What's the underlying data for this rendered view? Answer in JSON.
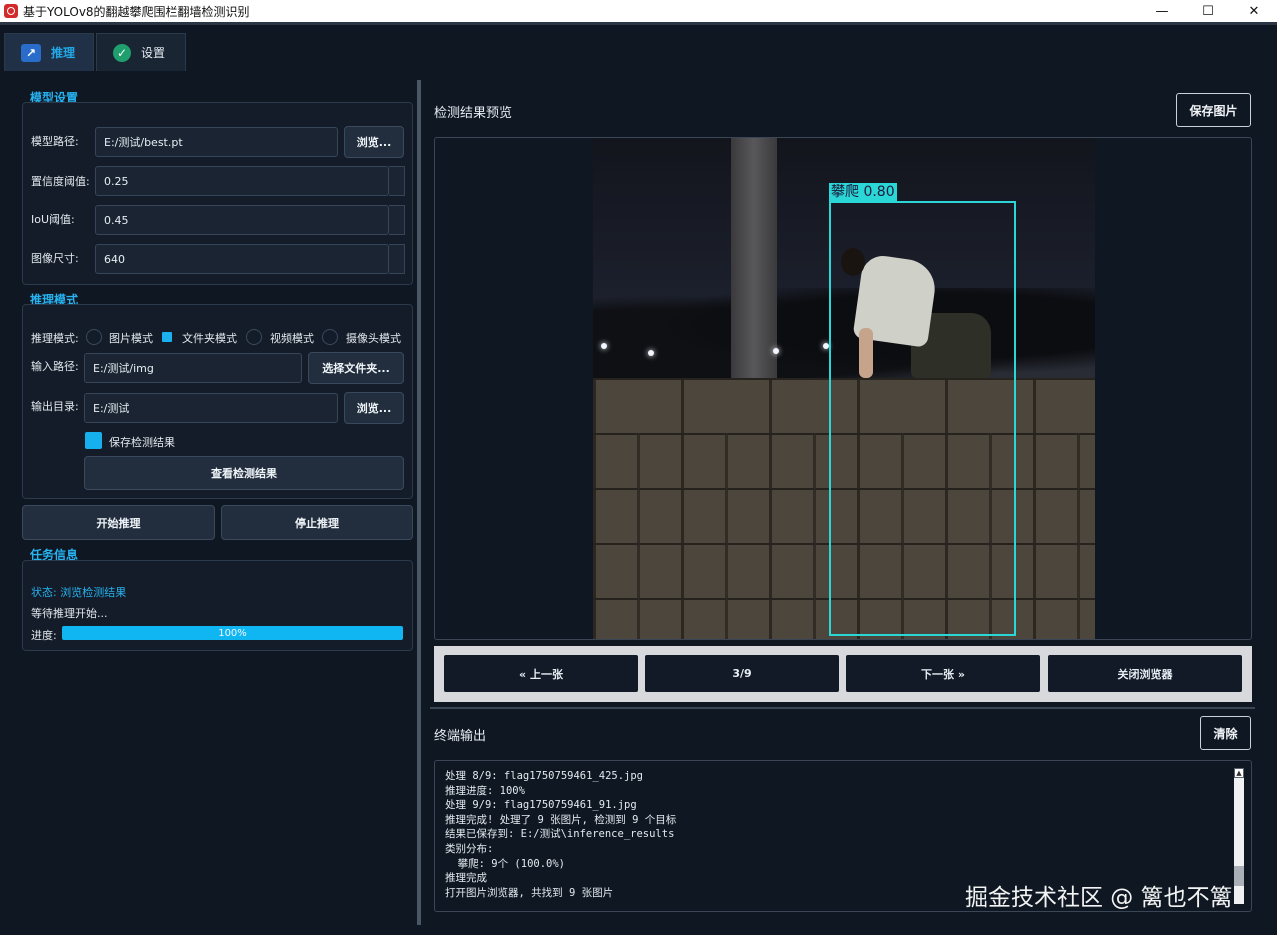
{
  "window": {
    "title": "基于YOLOv8的翻越攀爬围栏翻墙检测识别",
    "minimize": "—",
    "maximize": "☐",
    "close": "✕"
  },
  "tabs": [
    {
      "label": "推理",
      "icon": "chart-icon"
    },
    {
      "label": "设置",
      "icon": "check-icon"
    }
  ],
  "model_settings": {
    "title": "模型设置",
    "model_path_label": "模型路径:",
    "model_path_value": "E:/测试/best.pt",
    "browse_label": "浏览...",
    "conf_label": "置信度阈值:",
    "conf_value": "0.25",
    "iou_label": "IoU阈值:",
    "iou_value": "0.45",
    "imgsz_label": "图像尺寸:",
    "imgsz_value": "640"
  },
  "inference_mode": {
    "title": "推理模式",
    "mode_label": "推理模式:",
    "modes": [
      "图片模式",
      "文件夹模式",
      "视频模式",
      "摄像头模式"
    ],
    "selected_mode": "文件夹模式",
    "input_label": "输入路径:",
    "input_value": "E:/测试/img",
    "select_folder_label": "选择文件夹...",
    "output_label": "输出目录:",
    "output_value": "E:/测试",
    "browse_label": "浏览...",
    "save_results_label": "保存检测结果",
    "save_results_checked": true,
    "view_results_label": "查看检测结果"
  },
  "actions": {
    "start_label": "开始推理",
    "stop_label": "停止推理"
  },
  "task_info": {
    "title": "任务信息",
    "status_text": "状态: 浏览检测结果",
    "waiting_text": "等待推理开始...",
    "progress_label": "进度:",
    "progress_value": 1.0,
    "progress_text": "100%"
  },
  "preview": {
    "title": "检测结果预览",
    "save_image_label": "保存图片",
    "detection_label": "攀爬 0.80",
    "box_color": "#2ad6d6"
  },
  "navigator": {
    "prev_label": "« 上一张",
    "page_text": "3/9",
    "next_label": "下一张 »",
    "close_label": "关闭浏览器"
  },
  "terminal": {
    "title": "终端输出",
    "clear_label": "清除",
    "lines": [
      "处理 8/9: flag1750759461_425.jpg",
      "推理进度: 100%",
      "处理 9/9: flag1750759461_91.jpg",
      "推理完成! 处理了 9 张图片, 检测到 9 个目标",
      "结果已保存到: E:/测试\\inference_results",
      "类别分布:",
      "  攀爬: 9个 (100.0%)",
      "推理完成",
      "打开图片浏览器, 共找到 9 张图片"
    ]
  },
  "watermark": "掘金技术社区 @ 篱也不篱",
  "colors": {
    "accent": "#27b2f0",
    "background": "#0f1722",
    "progress": "#10b6f2"
  }
}
